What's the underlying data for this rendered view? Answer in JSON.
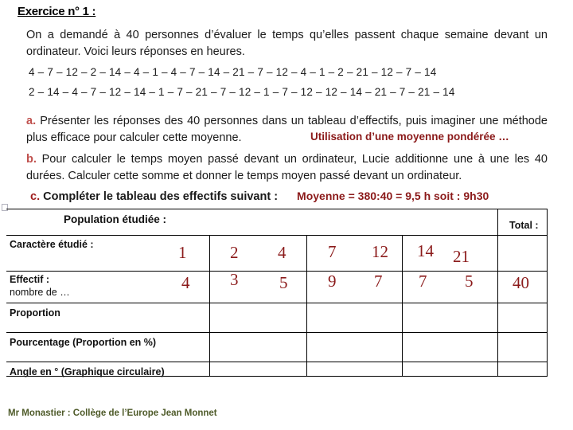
{
  "title": "Exercice n° 1 :",
  "statement": "On a demandé à 40 personnes d’évaluer le temps qu’elles passent chaque semaine devant un ordinateur. Voici leurs réponses en heures.",
  "data_rows": [
    "4 – 7 – 12 – 2 – 14 – 4 – 1 – 4 – 7 – 14 – 21 – 7 – 12 – 4 – 1 – 2 – 21 – 12 – 7 – 14",
    "2 – 14 – 4 – 7 – 12 – 14 – 1 – 7 – 21 – 7 – 12 – 1 – 7 – 12 – 12 – 14 – 21 – 7 – 21 – 14"
  ],
  "questions": {
    "a": {
      "marker": "a.",
      "text": " Présenter les réponses des 40 personnes dans un tableau d’effectifs, puis imaginer une méthode plus efficace pour calculer cette moyenne.",
      "annotation": "Utilisation d’une moyenne pondérée …"
    },
    "b": {
      "marker": "b.",
      "text": " Pour calculer le temps moyen passé devant un ordinateur, Lucie additionne une à une les 40 durées. Calculer cette somme et donner le temps moyen passé devant un ordinateur."
    },
    "c": {
      "marker": "c.",
      "text": " Compléter le tableau des effectifs suivant :",
      "annotation": "Moyenne = 380:40 = 9,5 h soit :  9h30"
    }
  },
  "table": {
    "population_label": "Population étudiée :",
    "total_label": "Total :",
    "row_labels": [
      {
        "line1": "Caractère étudié :",
        "line2": ""
      },
      {
        "line1": "Effectif :",
        "line2": "nombre de  …"
      },
      {
        "line1": "Proportion",
        "line2": ""
      },
      {
        "line1": "Pourcentage  (Proportion en %)",
        "line2": ""
      },
      {
        "line1": "Angle en ° (Graphique circulaire)",
        "line2": ""
      }
    ],
    "caractere_values": [
      "1",
      "2",
      "4",
      "7",
      "12",
      "14",
      "21"
    ],
    "effectif_values": [
      "4",
      "3",
      "5",
      "9",
      "7",
      "7",
      "5"
    ],
    "effectif_total": "40",
    "empty_rows": [
      "Proportion",
      "Pourcentage  (Proportion en %)",
      "Angle en ° (Graphique circulaire)"
    ]
  },
  "footer": "Mr Monastier : Collège de l’Europe Jean Monnet",
  "colors": {
    "annotation_red": "#8B1A1A",
    "marker_red": "#C0504D",
    "footer_olive": "#4F5B2A",
    "text_black": "#1a1a1a"
  }
}
